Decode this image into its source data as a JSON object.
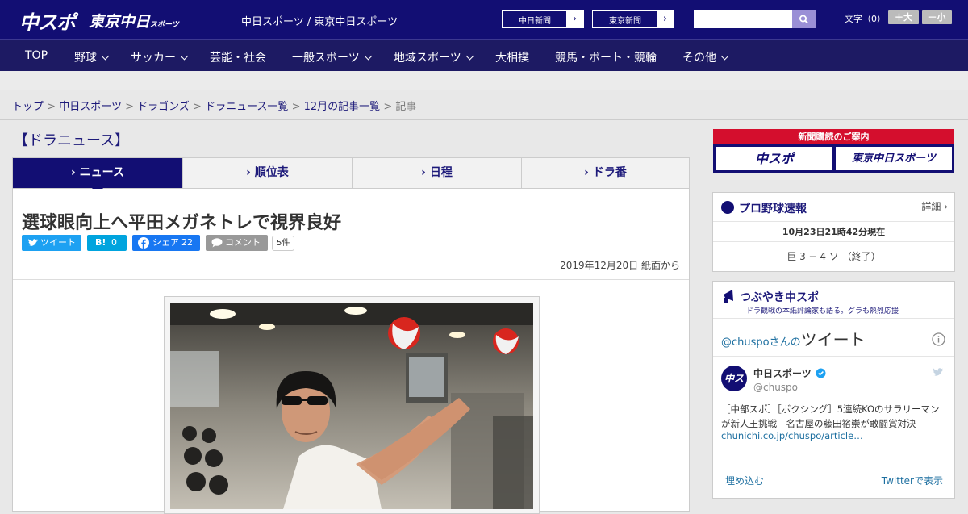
{
  "header": {
    "logo_main": "中スポ",
    "logo_sub": "東京中日",
    "logo_sub_small": "スポーツ",
    "site_title": "中日スポーツ / 東京中日スポーツ",
    "btn_chunichi": "中日新聞",
    "btn_tokyo": "東京新聞",
    "btn_arrow": "›",
    "search_placeholder": "",
    "font_size_label": "文字（0）",
    "font_plus": "＋大",
    "font_minus": "－小"
  },
  "nav": {
    "top": "TOP",
    "baseball": "野球",
    "soccer": "サッカー",
    "geino": "芸能・社会",
    "general": "一般スポーツ",
    "regional": "地域スポーツ",
    "sumo": "大相撲",
    "racing": "競馬・ボート・競輪",
    "other": "その他"
  },
  "breadcrumb": {
    "c1": "トップ",
    "c2": "中日スポーツ",
    "c3": "ドラゴンズ",
    "c4": "ドラニュース一覧",
    "c5": "12月の記事一覧",
    "current": "記事",
    "sep": ">"
  },
  "section_title": "【ドラニュース】",
  "tabs": {
    "news": "ニュース",
    "standings": "順位表",
    "schedule": "日程",
    "drabann": "ドラ番"
  },
  "article": {
    "headline": "選球眼向上へ平田メガネトレで視界良好",
    "tweet": "ツイート",
    "hatena": "B!",
    "hatena_count": "0",
    "share": "シェア",
    "share_count": "22",
    "comment": "コメント",
    "comment_count": "5件",
    "date": "2019年12月20日 紙面から"
  },
  "sidebar": {
    "subscribe_header": "新聞購読のご案内",
    "subscribe_chuspo": "中スポ",
    "subscribe_tokyo": "東京中日スポーツ",
    "baseball": {
      "title": "プロ野球速報",
      "detail": "詳細 ›",
      "timestamp": "10月23日21時42分現在",
      "score": "巨 3 − 4 ソ （終了）"
    },
    "tsubuyaki": {
      "title": "つぶやき中スポ",
      "subtitle": "ドラ観戦の本紙評論家も語る。グラも熱烈応援",
      "handle_prefix": "@chuspoさんの",
      "tweet_word": "ツイート",
      "user_name": "中日スポーツ",
      "user_handle": "@chuspo",
      "tweet_text": "［中部スポ］［ボクシング］5連続KOのサラリーマンが新人王挑戦　名古屋の藤田裕崇が敢闘賞対決",
      "tweet_link": "chunichi.co.jp/chuspo/article…",
      "embed": "埋め込む",
      "view_on": "Twitterで表示"
    }
  },
  "colors": {
    "brand_navy": "#120e73",
    "nav": "#1d1a63",
    "red": "#d40e2d",
    "twitter": "#1da1f2",
    "hatena": "#00a4de",
    "facebook": "#1877f2"
  }
}
